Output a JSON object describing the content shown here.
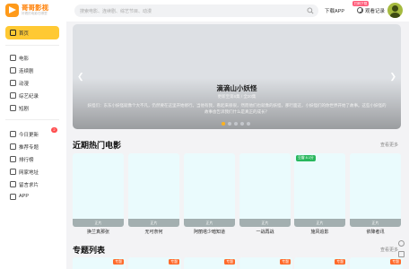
{
  "header": {
    "logo_name": "哥哥影视",
    "logo_sub": "好看的电影在哪里",
    "search_placeholder": "搜索电影、连续剧、综艺节目、动漫",
    "download_label": "下载APP",
    "download_badge": "扫码下载",
    "history_label": "观看记录"
  },
  "sidebar": {
    "items": [
      {
        "label": "首页",
        "icon": "home-icon",
        "active": true
      },
      {
        "label": "电影",
        "icon": "film-icon"
      },
      {
        "label": "连续剧",
        "icon": "tv-icon"
      },
      {
        "label": "动漫",
        "icon": "anime-icon"
      },
      {
        "label": "综艺纪录",
        "icon": "variety-icon"
      },
      {
        "label": "短剧",
        "icon": "short-drama-icon"
      },
      {
        "label": "今日更新",
        "icon": "update-icon",
        "badge": "2"
      },
      {
        "label": "推荐专题",
        "icon": "topic-icon"
      },
      {
        "label": "排行榜",
        "icon": "ranking-icon"
      },
      {
        "label": "网家地址",
        "icon": "address-icon"
      },
      {
        "label": "留言求片",
        "icon": "message-icon"
      },
      {
        "label": "APP",
        "icon": "app-icon"
      }
    ]
  },
  "banner": {
    "title": "滴滴山小妖怪",
    "subtitle": "更新至第6集 / 全20集",
    "description": "妖怪们：东东小妖怪就像个大不凡，仍然要在这里开始修行。当他有我，看起来很很，然而他们也就像的妖怪，那行面这，小妖怪们的你世界开始了故事。这些小妖怪的故事会告诉我们什么是真正的成长？"
  },
  "hot_movies": {
    "title": "近期热门电影",
    "more": "查看更多",
    "cards": [
      {
        "name": "换兰真那张",
        "tag": "正片"
      },
      {
        "name": "无可奈何",
        "tag": "正片"
      },
      {
        "name": "阿丽塔少暗知道",
        "tag": "正片"
      },
      {
        "name": "一战再战",
        "tag": "正片"
      },
      {
        "name": "施风追影",
        "tag": "正片",
        "badge": "豆瓣 8.1分"
      },
      {
        "name": "依降者讯",
        "tag": "正片"
      }
    ]
  },
  "topics": {
    "title": "专题列表",
    "more": "查看更多",
    "badges": [
      "专题",
      "专题",
      "专题",
      "专题",
      "专题",
      "专题"
    ]
  },
  "colors": {
    "accent": "#ffc933",
    "brand": "#ff7d00",
    "poster_bg": "#eafbfd",
    "badge_green": "#28b75d",
    "badge_orange": "#ff6a2a"
  }
}
